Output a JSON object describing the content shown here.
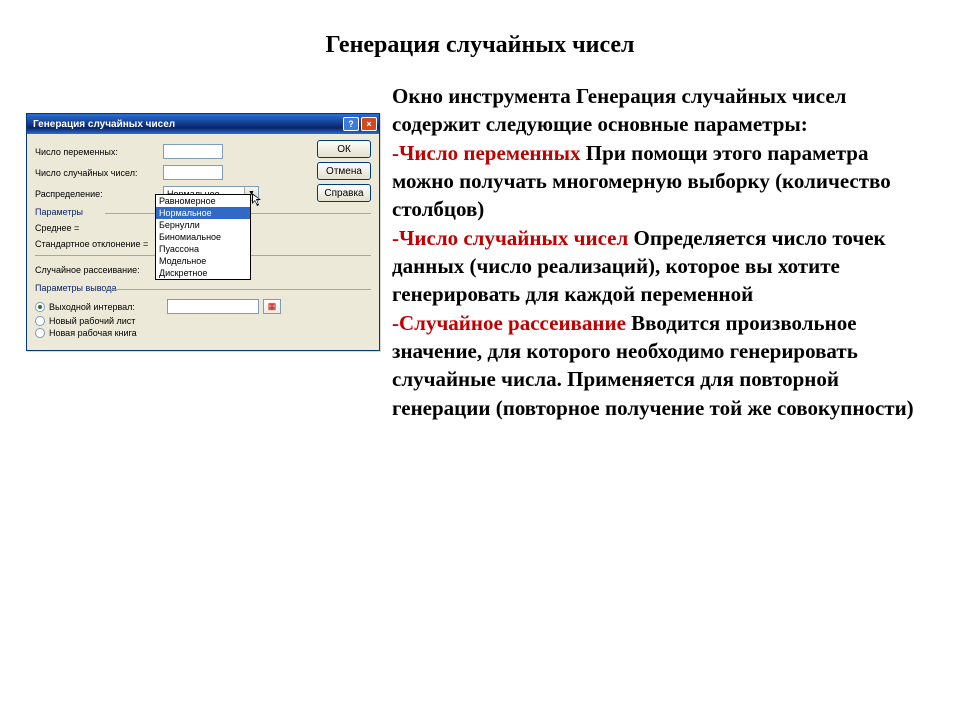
{
  "page": {
    "title": "Генерация случайных чисел"
  },
  "desc": {
    "intro": "Окно инструмента Генерация случайных чисел содержит следующие основные параметры:",
    "items": [
      {
        "term": "-Число переменных",
        "body": " При помощи этого параметра можно получать многомерную выборку (количество столбцов)"
      },
      {
        "term": "-Число случайных чисел",
        "body": " Определяется число точек данных (число реализаций), которое вы хотите генерировать для каждой переменной"
      },
      {
        "term": "-Случайное рассеивание",
        "body": " Вводится произвольное значение, для которого необходимо генерировать случайные числа. Применяется для повторной генерации (повторное получение той же совокупности)"
      }
    ]
  },
  "dialog": {
    "title": "Генерация случайных чисел",
    "help_glyph": "?",
    "close_glyph": "×",
    "buttons": {
      "ok": "ОК",
      "cancel": "Отмена",
      "help": "Справка"
    },
    "field_vars": {
      "label": "Число переменных:"
    },
    "field_count": {
      "label": "Число случайных чисел:"
    },
    "field_dist": {
      "label": "Распределение:",
      "value": "Нормальное"
    },
    "dist_options": [
      "Равномерное",
      "Нормальное",
      "Бернулли",
      "Биномиальное",
      "Пуассона",
      "Модельное",
      "Дискретное"
    ],
    "group_params": "Параметры",
    "param_mean": {
      "label": "Среднее ="
    },
    "param_stddev": {
      "label": "Стандартное отклонение ="
    },
    "field_seed": {
      "label": "Случайное рассеивание:"
    },
    "group_output": "Параметры вывода",
    "out_range": {
      "label": "Выходной интервал:"
    },
    "out_sheet": {
      "label": "Новый рабочий лист"
    },
    "out_book": {
      "label": "Новая рабочая книга"
    }
  }
}
